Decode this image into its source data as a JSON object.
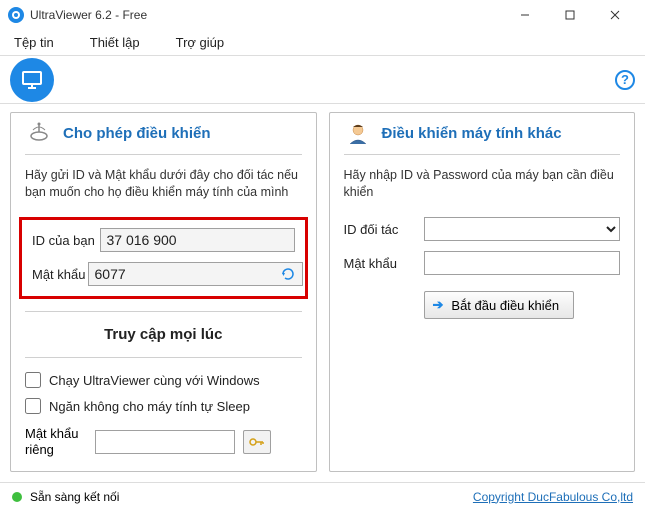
{
  "window": {
    "title": "UltraViewer 6.2 - Free"
  },
  "menu": {
    "file": "Tệp tin",
    "setup": "Thiết lập",
    "help": "Trợ giúp"
  },
  "left_panel": {
    "title": "Cho phép điều khiển",
    "desc": "Hãy gửi ID và Mật khẩu dưới đây cho đối tác nếu bạn muốn cho họ điều khiển máy tính của mình",
    "id_label": "ID của bạn",
    "id_value": "37 016 900",
    "pw_label": "Mật khẩu",
    "pw_value": "6077",
    "access_title": "Truy cập mọi lúc",
    "run_with_windows": "Chạy UltraViewer cùng với Windows",
    "prevent_sleep": "Ngăn không cho máy tính tự Sleep",
    "private_pw_label": "Mật khẩu riêng",
    "private_pw_value": ""
  },
  "right_panel": {
    "title": "Điều khiển máy tính khác",
    "desc": "Hãy nhập ID và Password của máy bạn cần điều khiển",
    "partner_id_label": "ID đối tác",
    "partner_id_value": "",
    "pw_label": "Mật khẩu",
    "pw_value": "",
    "start_btn": "Bắt đầu điều khiển"
  },
  "status": {
    "ready": "Sẵn sàng kết nối",
    "copyright": "Copyright DucFabulous Co,ltd"
  }
}
